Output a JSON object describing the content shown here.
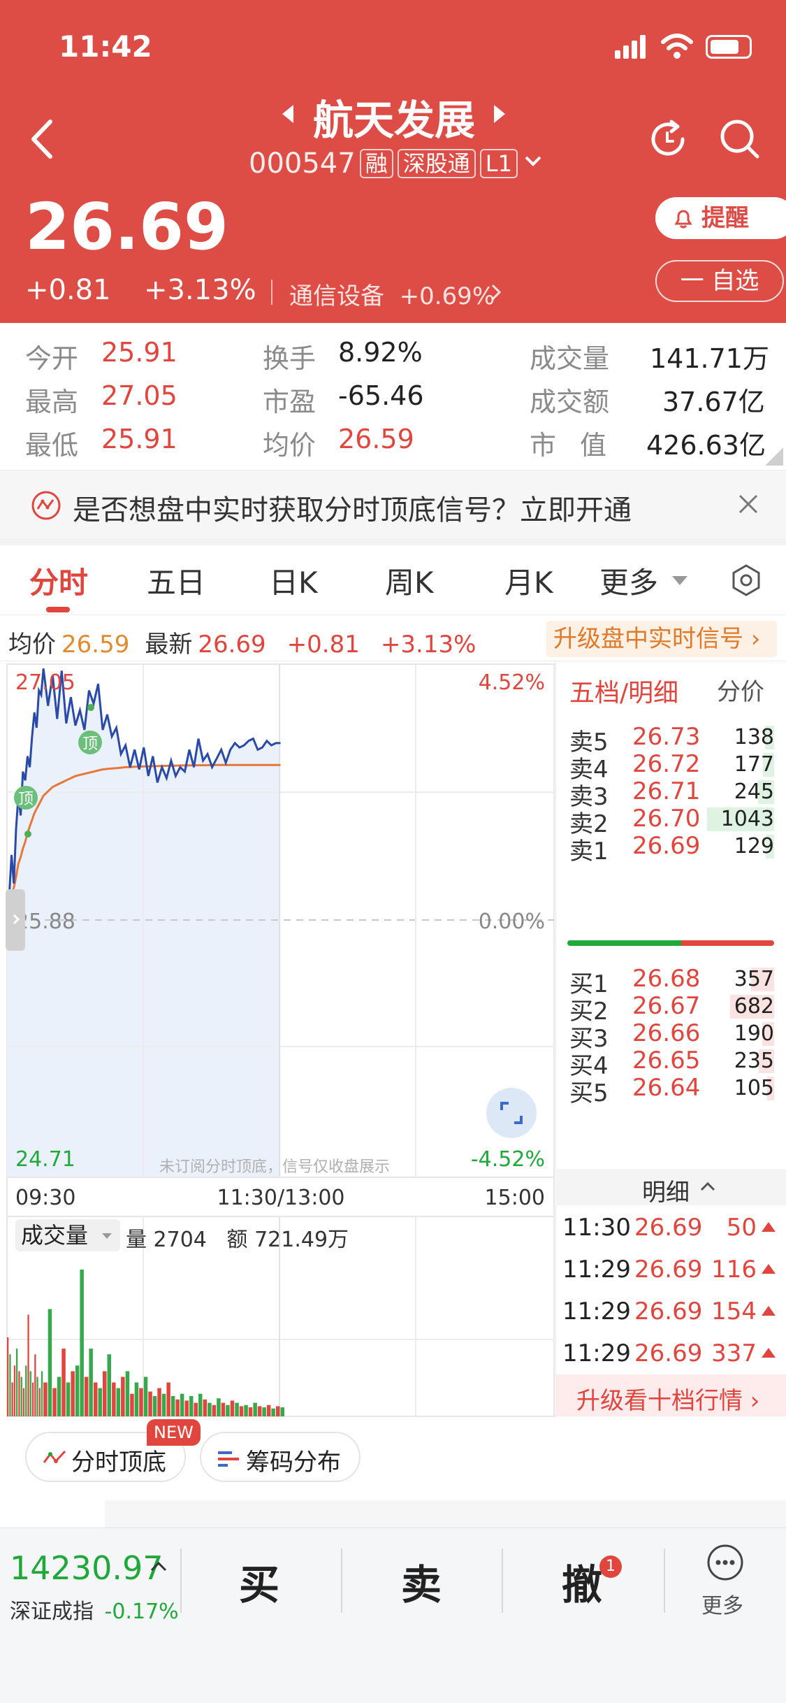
{
  "status_bar": {
    "time": "11:42"
  },
  "header": {
    "stock_name": "航天发展",
    "stock_code": "000547",
    "tags": [
      "融",
      "深股通",
      "L1"
    ],
    "alert_label": "提醒",
    "watch_label": "一 自选"
  },
  "quote": {
    "price": "26.69",
    "change": "+0.81",
    "change_pct": "+3.13%",
    "sector": "通信设备",
    "sector_change": "+0.69%"
  },
  "stats": [
    {
      "label": "今开",
      "value": "25.91"
    },
    {
      "label": "最高",
      "value": "27.05"
    },
    {
      "label": "最低",
      "value": "25.91"
    },
    {
      "label": "换手",
      "value": "8.92%"
    },
    {
      "label": "市盈",
      "value": "-65.46"
    },
    {
      "label": "均价",
      "value": "26.59"
    },
    {
      "label": "成交量",
      "value": "141.71万"
    },
    {
      "label": "成交额",
      "value": "37.67亿"
    },
    {
      "label": "市值",
      "value": "426.63亿"
    }
  ],
  "banner": {
    "text": "是否想盘中实时获取分时顶底信号？立即开通"
  },
  "tabs": [
    "分时",
    "五日",
    "日K",
    "周K",
    "月K",
    "更多"
  ],
  "info": {
    "avg_label": "均价",
    "avg_value": "26.59",
    "latest_label": "最新",
    "latest_value": "26.69",
    "change": "+0.81",
    "change_pct": "+3.13%",
    "upgrade_label": "升级盘中实时信号 ›"
  },
  "chart": {
    "y_max": "27.05",
    "y_base": "25.88",
    "y_min": "24.71",
    "pct_max": "4.52%",
    "pct_base": "0.00%",
    "pct_min": "-4.52%",
    "time_start": "09:30",
    "time_mid": "11:30/13:00",
    "time_end": "15:00",
    "marker_label": "顶",
    "watermark": "未订阅分时顶底，信号仅收盘展示"
  },
  "chart_data": {
    "type": "line",
    "x_minutes": [
      0,
      1,
      2,
      3,
      4,
      5,
      6,
      7,
      8,
      9,
      10,
      11,
      12,
      13,
      14,
      15,
      16,
      18,
      20,
      22,
      24,
      26,
      28,
      30,
      32,
      34,
      36,
      38,
      40,
      42,
      44,
      46,
      48,
      50,
      52,
      54,
      56,
      58,
      60,
      62,
      64,
      66,
      68,
      70,
      72,
      74,
      76,
      78,
      80,
      82,
      84,
      86,
      88,
      90,
      92,
      94,
      96,
      98,
      100,
      102,
      104,
      106,
      108,
      110,
      112,
      114,
      116,
      118,
      120
    ],
    "price": [
      25.9,
      26.0,
      26.18,
      26.05,
      26.3,
      26.45,
      26.36,
      26.56,
      26.52,
      26.63,
      26.58,
      26.72,
      26.83,
      26.76,
      26.93,
      26.91,
      27.03,
      26.86,
      27.0,
      26.8,
      27.02,
      26.78,
      26.9,
      26.77,
      26.84,
      26.75,
      26.93,
      26.87,
      26.96,
      26.75,
      26.82,
      26.72,
      26.76,
      26.64,
      26.68,
      26.58,
      26.66,
      26.57,
      26.67,
      26.54,
      26.63,
      26.51,
      26.58,
      26.53,
      26.61,
      26.54,
      26.58,
      26.56,
      26.66,
      26.58,
      26.71,
      26.61,
      26.64,
      26.58,
      26.62,
      26.66,
      26.6,
      26.66,
      26.69,
      26.67,
      26.68,
      26.7,
      26.71,
      26.66,
      26.67,
      26.7,
      26.68,
      26.69,
      26.69
    ],
    "avg_price": [
      25.9,
      25.94,
      26.0,
      26.03,
      26.08,
      26.14,
      26.17,
      26.21,
      26.24,
      26.28,
      26.31,
      26.34,
      26.37,
      26.39,
      26.41,
      26.43,
      26.45,
      26.47,
      26.49,
      26.5,
      26.51,
      26.52,
      26.53,
      26.54,
      26.545,
      26.55,
      26.555,
      26.56,
      26.565,
      26.57,
      26.572,
      26.574,
      26.576,
      26.578,
      26.58,
      26.58,
      26.582,
      26.582,
      26.584,
      26.584,
      26.585,
      26.585,
      26.586,
      26.586,
      26.587,
      26.587,
      26.588,
      26.588,
      26.588,
      26.589,
      26.589,
      26.589,
      26.589,
      26.59,
      26.59,
      26.59,
      26.59,
      26.59,
      26.59,
      26.59,
      26.59,
      26.59,
      26.59,
      26.59,
      26.59,
      26.59,
      26.59,
      26.59,
      26.59
    ],
    "volume": [
      70,
      55,
      30,
      45,
      60,
      40,
      35,
      25,
      45,
      90,
      40,
      30,
      55,
      35,
      25,
      40,
      30,
      95,
      25,
      35,
      60,
      30,
      40,
      45,
      130,
      35,
      60,
      30,
      25,
      40,
      55,
      30,
      25,
      35,
      40,
      20,
      30,
      25,
      35,
      22,
      18,
      25,
      20,
      30,
      18,
      15,
      20,
      14,
      18,
      12,
      20,
      15,
      12,
      10,
      16,
      12,
      10,
      14,
      12,
      9,
      10,
      8,
      12,
      9,
      8,
      10,
      7,
      9,
      8
    ],
    "volume_up": [
      true,
      false,
      true,
      true,
      false,
      true,
      false,
      true,
      false,
      true,
      false,
      true,
      true,
      false,
      true,
      false,
      true,
      false,
      true,
      false,
      true,
      false,
      true,
      false,
      false,
      true,
      false,
      true,
      false,
      true,
      false,
      true,
      false,
      true,
      false,
      true,
      false,
      true,
      false,
      true,
      false,
      true,
      false,
      true,
      false,
      true,
      false,
      true,
      false,
      true,
      false,
      true,
      false,
      true,
      false,
      true,
      false,
      true,
      false,
      true,
      false,
      true,
      false,
      true,
      false,
      true,
      false,
      true,
      false
    ],
    "y_range": [
      24.71,
      27.05
    ],
    "base_price": 25.88,
    "session_minutes": 240
  },
  "volume": {
    "indicator": "成交量",
    "qty_label": "量",
    "qty": "2704",
    "amt_label": "额",
    "amt": "721.49万"
  },
  "orderbook": {
    "title": "五档/明细",
    "tab_price": "分价",
    "asks": [
      {
        "label": "卖5",
        "price": "26.73",
        "vol": "138"
      },
      {
        "label": "卖4",
        "price": "26.72",
        "vol": "177"
      },
      {
        "label": "卖3",
        "price": "26.71",
        "vol": "245"
      },
      {
        "label": "卖2",
        "price": "26.70",
        "vol": "1043"
      },
      {
        "label": "卖1",
        "price": "26.69",
        "vol": "129"
      }
    ],
    "bids": [
      {
        "label": "买1",
        "price": "26.68",
        "vol": "357"
      },
      {
        "label": "买2",
        "price": "26.67",
        "vol": "682"
      },
      {
        "label": "买3",
        "price": "26.66",
        "vol": "190"
      },
      {
        "label": "买4",
        "price": "26.65",
        "vol": "235"
      },
      {
        "label": "买5",
        "price": "26.64",
        "vol": "105"
      }
    ],
    "detail_label": "明细",
    "trades": [
      {
        "time": "11:30",
        "price": "26.69",
        "vol": "50"
      },
      {
        "time": "11:29",
        "price": "26.69",
        "vol": "116"
      },
      {
        "time": "11:29",
        "price": "26.69",
        "vol": "154"
      },
      {
        "time": "11:29",
        "price": "26.69",
        "vol": "337"
      }
    ],
    "upgrade_label": "升级看十档行情 ›"
  },
  "chips": [
    "分时顶底",
    "筹码分布"
  ],
  "chips_badge": "NEW",
  "bottom": {
    "index_value": "14230.97",
    "index_name": "深证成指",
    "index_change": "-0.17%",
    "buy": "买",
    "sell": "卖",
    "cancel": "撤",
    "cancel_badge": "1",
    "more": "更多"
  }
}
